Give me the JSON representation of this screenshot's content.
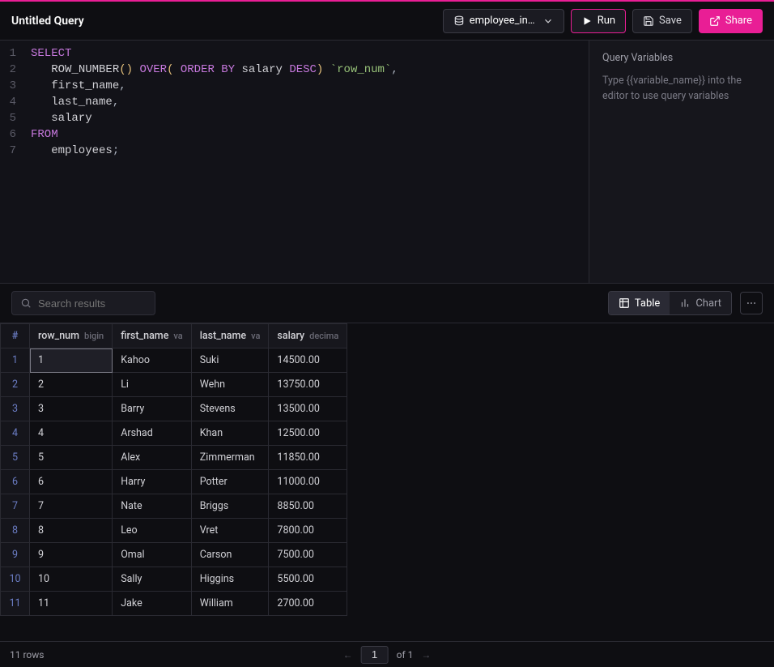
{
  "header": {
    "title": "Untitled Query",
    "database_label": "employee_inform…",
    "run_label": "Run",
    "save_label": "Save",
    "share_label": "Share"
  },
  "editor_lines": [
    [
      {
        "t": "SELECT",
        "c": "kw"
      }
    ],
    [
      {
        "t": "   ",
        "c": "plain"
      },
      {
        "t": "ROW_NUMBER",
        "c": "plain"
      },
      {
        "t": "()",
        "c": "id"
      },
      {
        "t": " ",
        "c": "plain"
      },
      {
        "t": "OVER",
        "c": "kw"
      },
      {
        "t": "(",
        "c": "id"
      },
      {
        "t": " ",
        "c": "plain"
      },
      {
        "t": "ORDER BY ",
        "c": "kw"
      },
      {
        "t": "salary ",
        "c": "plain"
      },
      {
        "t": "DESC",
        "c": "kw"
      },
      {
        "t": ")",
        "c": "id"
      },
      {
        "t": " ",
        "c": "plain"
      },
      {
        "t": "`row_num`",
        "c": "str"
      },
      {
        "t": ",",
        "c": "pn"
      }
    ],
    [
      {
        "t": "   first_name",
        "c": "plain"
      },
      {
        "t": ",",
        "c": "pn"
      }
    ],
    [
      {
        "t": "   last_name",
        "c": "plain"
      },
      {
        "t": ",",
        "c": "pn"
      }
    ],
    [
      {
        "t": "   salary",
        "c": "plain"
      }
    ],
    [
      {
        "t": "FROM",
        "c": "kw"
      }
    ],
    [
      {
        "t": "   employees",
        "c": "plain"
      },
      {
        "t": ";",
        "c": "pn"
      }
    ]
  ],
  "variables_panel": {
    "title": "Query Variables",
    "hint": "Type {{variable_name}} into the editor to use query variables"
  },
  "search": {
    "placeholder": "Search results"
  },
  "view_toggle": {
    "table": "Table",
    "chart": "Chart"
  },
  "columns": [
    {
      "name": "row_num",
      "type": "bigin"
    },
    {
      "name": "first_name",
      "type": "va"
    },
    {
      "name": "last_name",
      "type": "va"
    },
    {
      "name": "salary",
      "type": "decima"
    }
  ],
  "rows": [
    {
      "row_num": "1",
      "first_name": "Kahoo",
      "last_name": "Suki",
      "salary": "14500.00"
    },
    {
      "row_num": "2",
      "first_name": "Li",
      "last_name": "Wehn",
      "salary": "13750.00"
    },
    {
      "row_num": "3",
      "first_name": "Barry",
      "last_name": "Stevens",
      "salary": "13500.00"
    },
    {
      "row_num": "4",
      "first_name": "Arshad",
      "last_name": "Khan",
      "salary": "12500.00"
    },
    {
      "row_num": "5",
      "first_name": "Alex",
      "last_name": "Zimmerman",
      "salary": "11850.00"
    },
    {
      "row_num": "6",
      "first_name": "Harry",
      "last_name": "Potter",
      "salary": "11000.00"
    },
    {
      "row_num": "7",
      "first_name": "Nate",
      "last_name": "Briggs",
      "salary": "8850.00"
    },
    {
      "row_num": "8",
      "first_name": "Leo",
      "last_name": "Vret",
      "salary": "7800.00"
    },
    {
      "row_num": "9",
      "first_name": "Omal",
      "last_name": "Carson",
      "salary": "7500.00"
    },
    {
      "row_num": "10",
      "first_name": "Sally",
      "last_name": "Higgins",
      "salary": "5500.00"
    },
    {
      "row_num": "11",
      "first_name": "Jake",
      "last_name": "William",
      "salary": "2700.00"
    }
  ],
  "footer": {
    "row_count_label": "11 rows",
    "page": "1",
    "page_of": "of 1"
  }
}
